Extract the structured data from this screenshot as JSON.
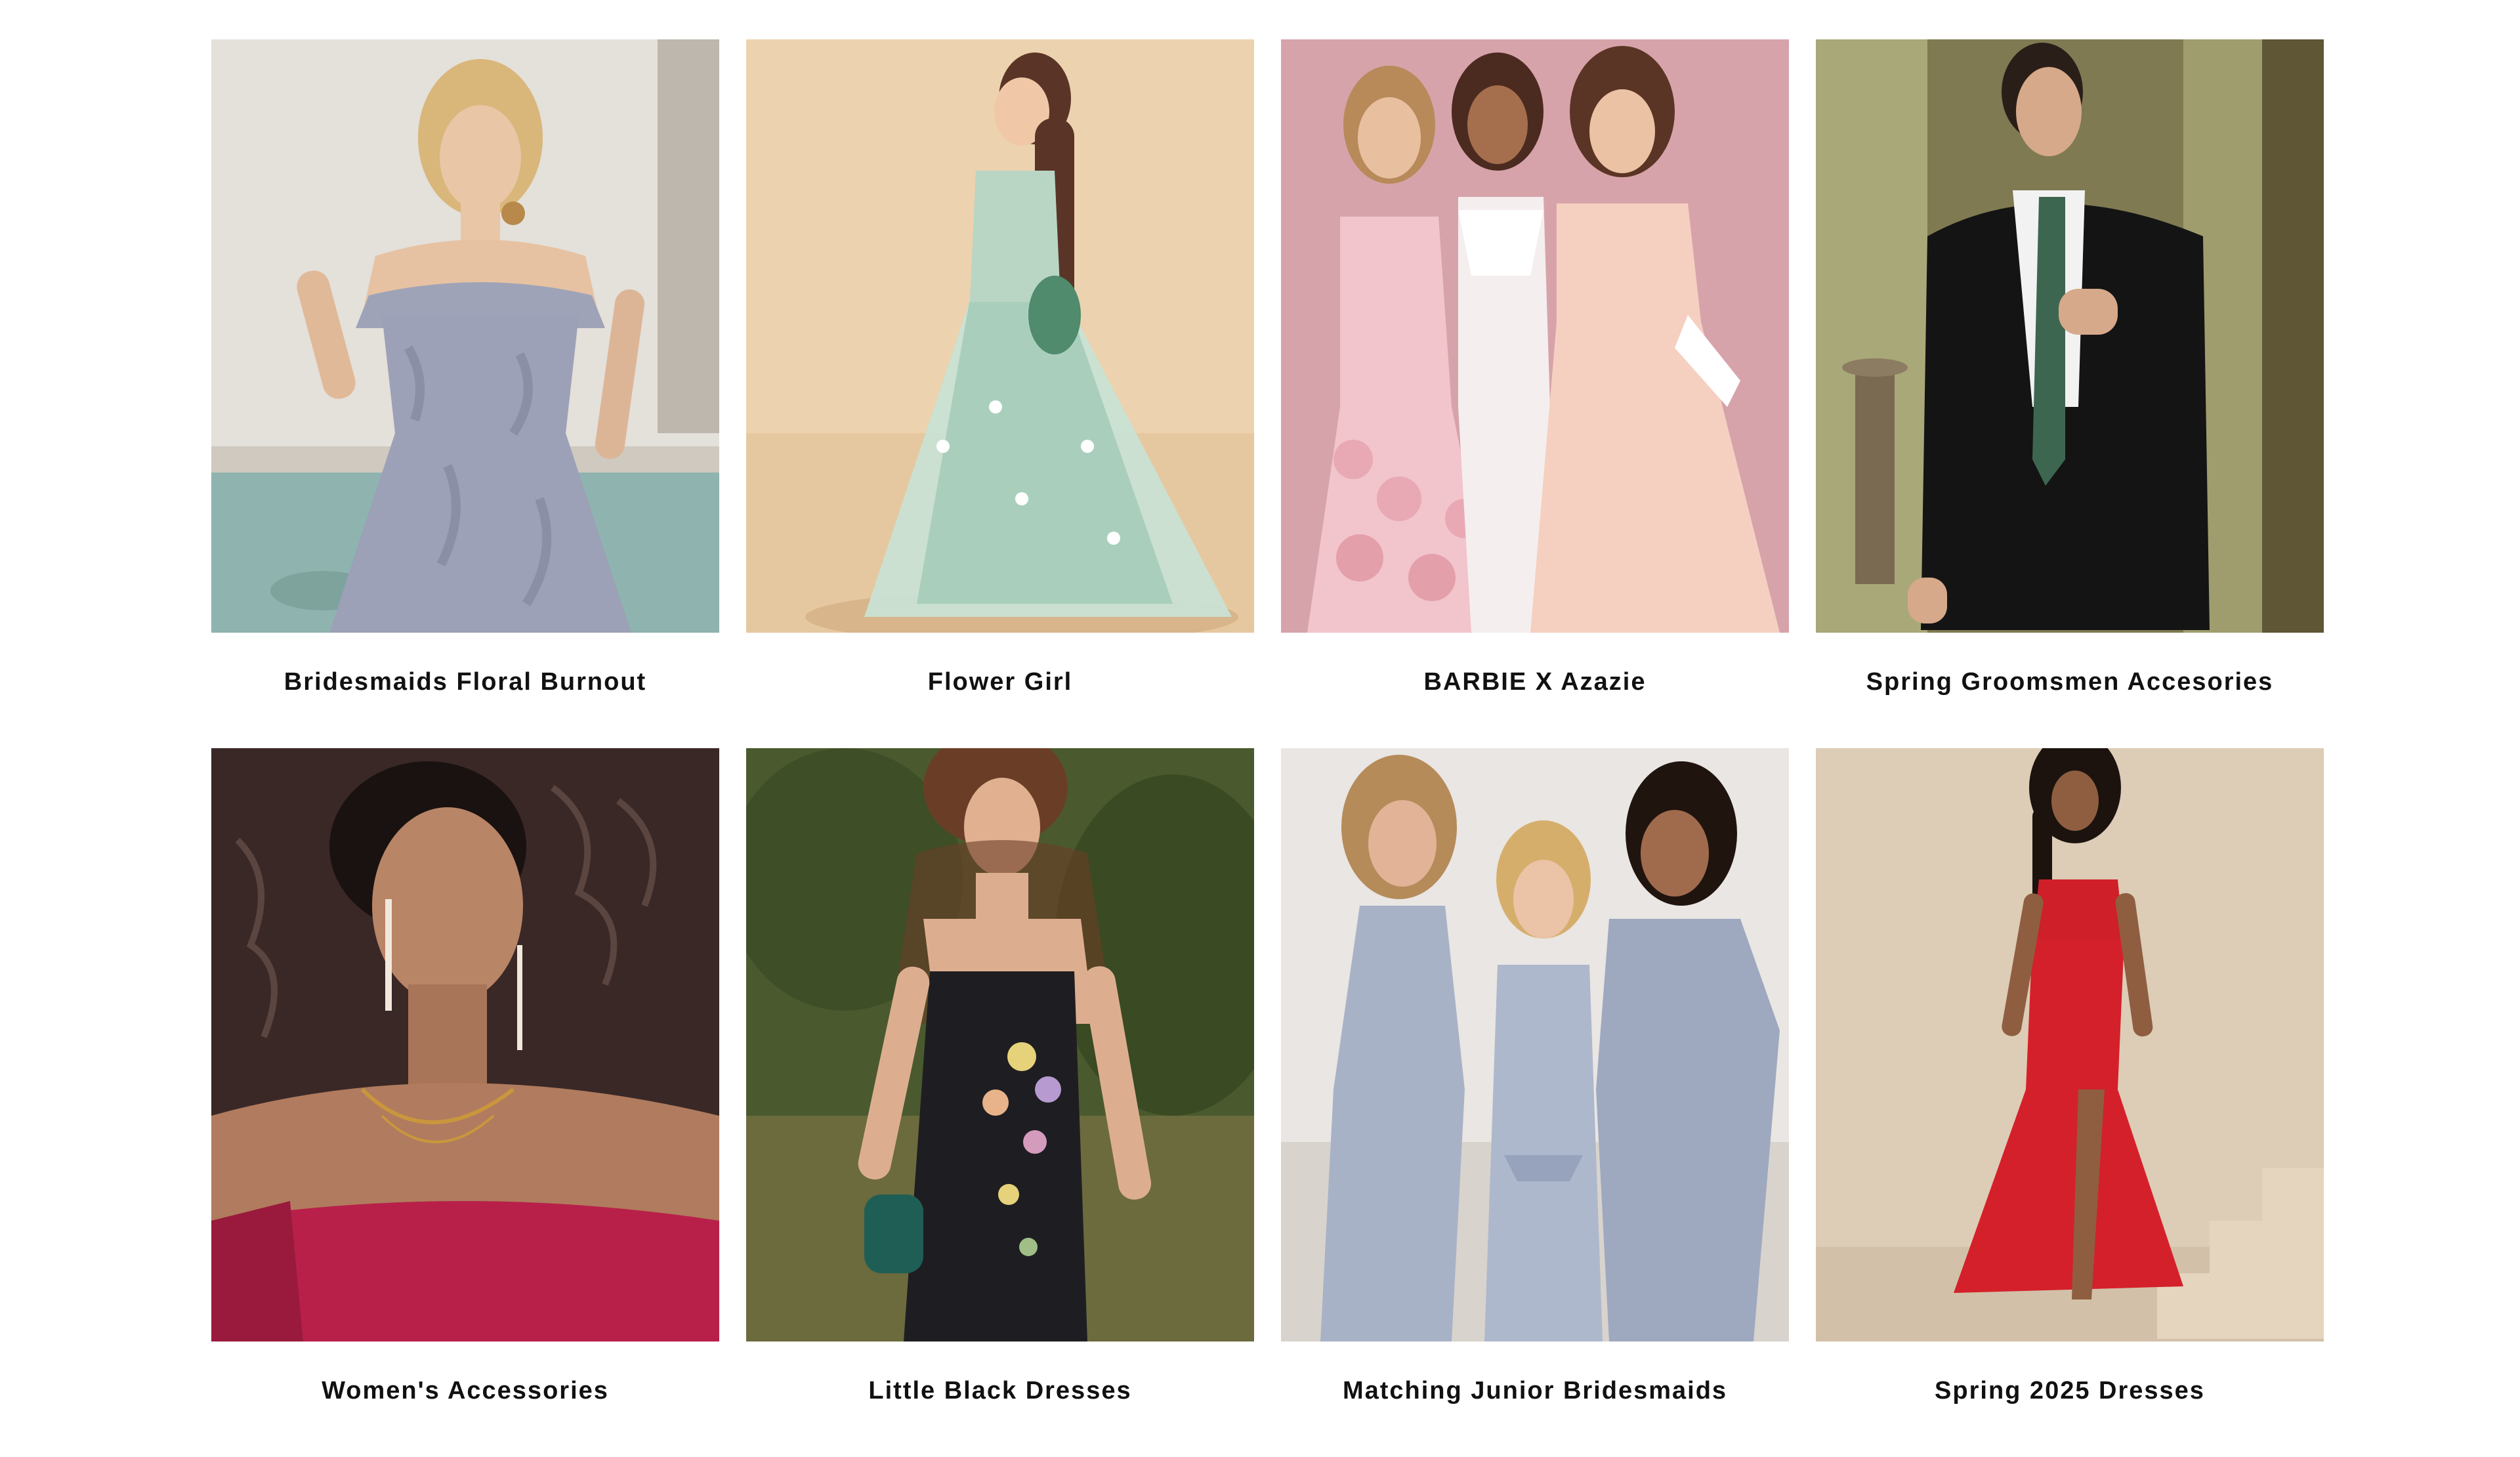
{
  "collections": [
    {
      "title": "Bridesmaids Floral Burnout",
      "image_desc": "bridesmaid-floral-burnout-photo"
    },
    {
      "title": "Flower Girl",
      "image_desc": "flower-girl-photo"
    },
    {
      "title": "BARBIE X Azazie",
      "image_desc": "barbie-azazie-photo"
    },
    {
      "title": "Spring Groomsmen Accesories",
      "image_desc": "groomsmen-photo"
    },
    {
      "title": "Women's Accessories",
      "image_desc": "womens-accessories-photo"
    },
    {
      "title": "Little Black Dresses",
      "image_desc": "little-black-dress-photo"
    },
    {
      "title": "Matching Junior Bridesmaids",
      "image_desc": "junior-bridesmaids-photo"
    },
    {
      "title": "Spring 2025 Dresses",
      "image_desc": "spring-2025-dress-photo"
    }
  ],
  "colors": {
    "text": "#111111",
    "background": "#ffffff"
  }
}
